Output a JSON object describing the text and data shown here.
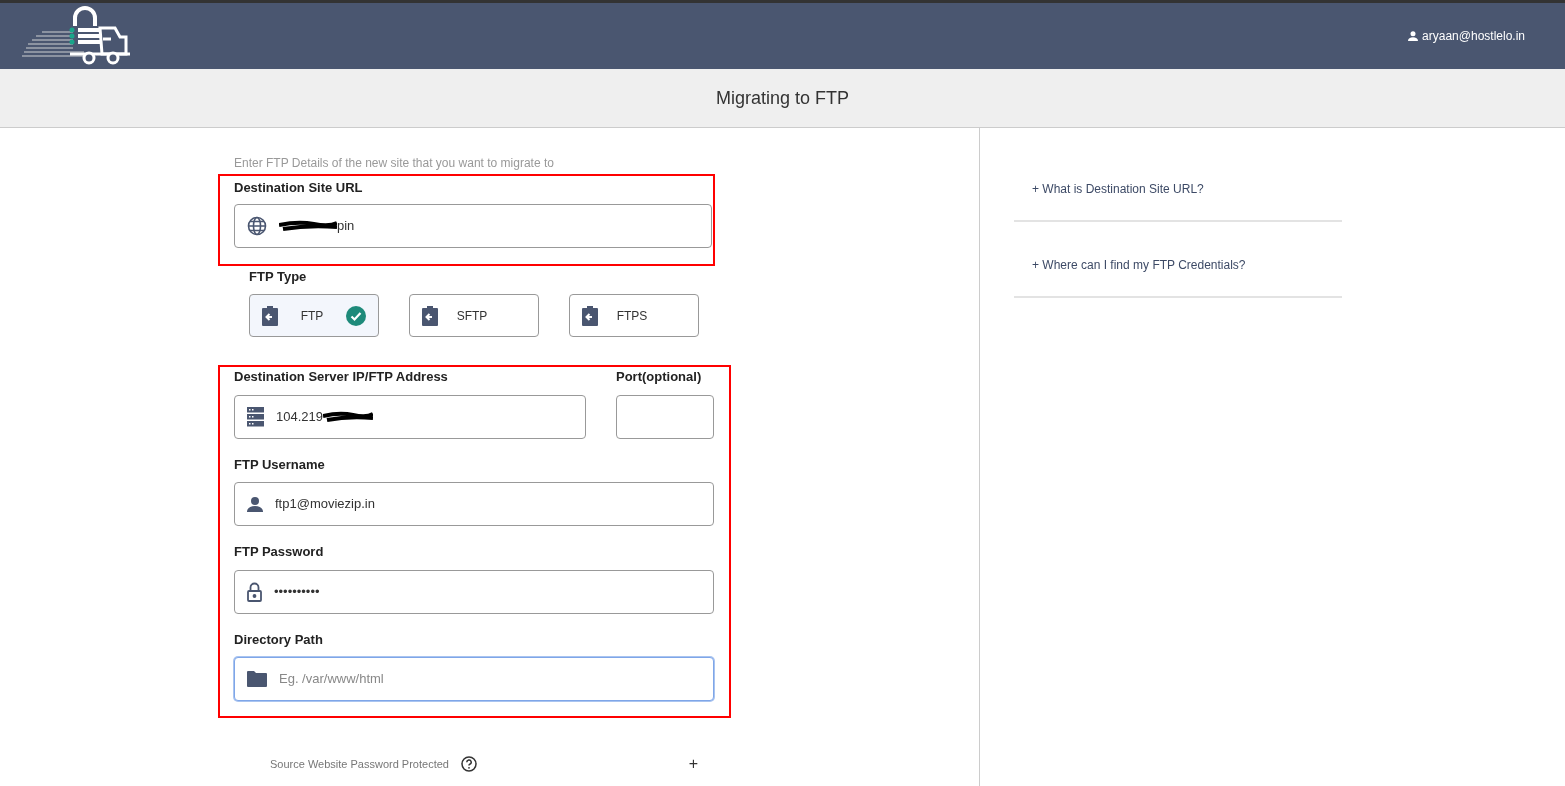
{
  "header": {
    "user": "aryaan@hostlelo.in"
  },
  "page_title": "Migrating to FTP",
  "form": {
    "hint": "Enter FTP Details of the new site that you want to migrate to",
    "site_url": {
      "label": "Destination Site URL",
      "value": "pin"
    },
    "ftp_type": {
      "label": "FTP Type",
      "options": [
        {
          "label": "FTP",
          "selected": true
        },
        {
          "label": "SFTP",
          "selected": false
        },
        {
          "label": "FTPS",
          "selected": false
        }
      ]
    },
    "server": {
      "label": "Destination Server IP/FTP Address",
      "value": "104.219"
    },
    "port": {
      "label": "Port(optional)"
    },
    "username": {
      "label": "FTP Username",
      "value": "ftp1@moviezip.in"
    },
    "password": {
      "label": "FTP Password",
      "value": "••••••••••"
    },
    "directory": {
      "label": "Directory Path",
      "placeholder": "Eg. /var/www/html",
      "focused": true
    }
  },
  "password_protected": {
    "label": "Source Website Password Protected",
    "toggle": "+"
  },
  "faq": [
    {
      "label": "+ What is Destination Site URL?"
    },
    {
      "label": "+ Where can I find my FTP Credentials?"
    }
  ]
}
